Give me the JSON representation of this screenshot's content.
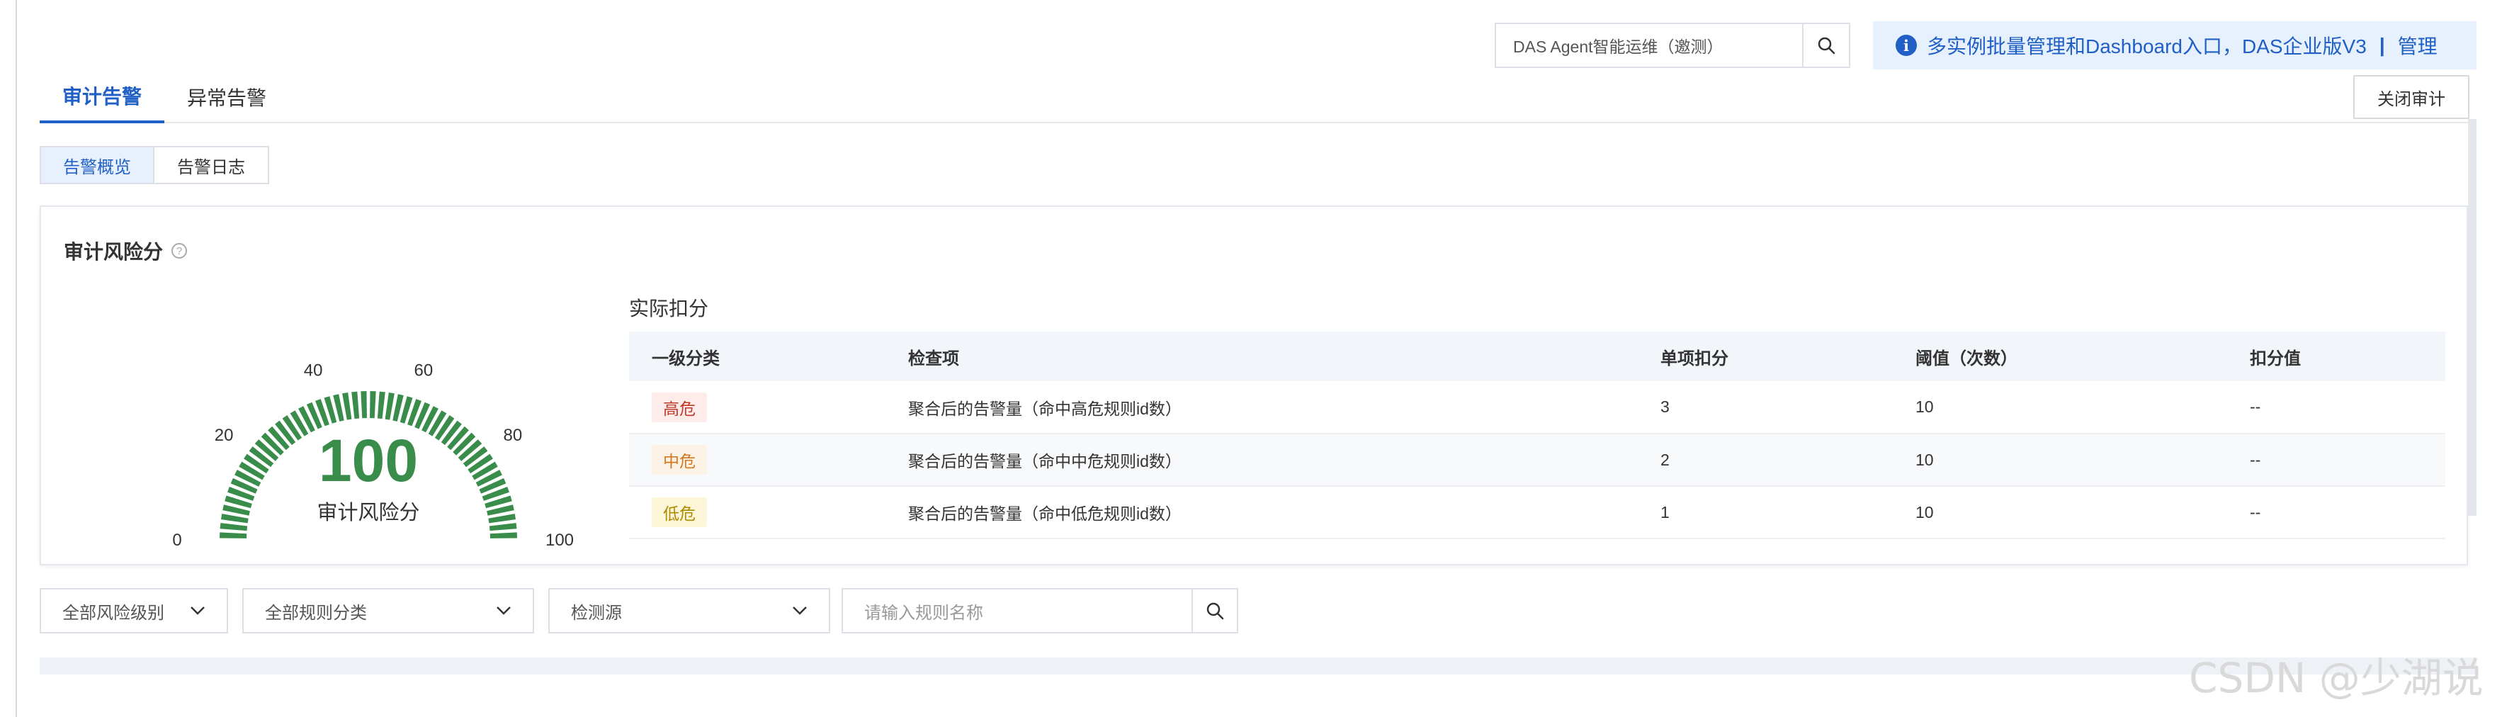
{
  "header": {
    "search_value": "DAS Agent智能运维（邀测）",
    "banner_text": "多实例批量管理和Dashboard入口，DAS企业版V3",
    "banner_sep": "|",
    "banner_link": "管理",
    "close_audit_label": "关闭审计"
  },
  "tabs": [
    {
      "label": "审计告警",
      "active": true
    },
    {
      "label": "异常告警",
      "active": false
    }
  ],
  "subtabs": [
    {
      "label": "告警概览",
      "active": true
    },
    {
      "label": "告警日志",
      "active": false
    }
  ],
  "risk_card": {
    "title": "审计风险分",
    "gauge": {
      "value": "100",
      "label": "审计风险分",
      "min": 0,
      "max": 100,
      "level": 100,
      "ticks": [
        "0",
        "20",
        "40",
        "60",
        "80",
        "100"
      ],
      "color": "#3a8c4b"
    },
    "deduction": {
      "title": "实际扣分",
      "columns": [
        "一级分类",
        "检查项",
        "单项扣分",
        "阈值（次数）",
        "扣分值"
      ],
      "rows": [
        {
          "level": "高危",
          "level_color": "#c0392b",
          "level_bg": "#fdecea",
          "item": "聚合后的告警量（命中高危规则id数）",
          "score": "3",
          "threshold": "10",
          "deduct": "--"
        },
        {
          "level": "中危",
          "level_color": "#d4781f",
          "level_bg": "#fdf2e6",
          "item": "聚合后的告警量（命中中危规则id数）",
          "score": "2",
          "threshold": "10",
          "deduct": "--"
        },
        {
          "level": "低危",
          "level_color": "#b08a00",
          "level_bg": "#fdf6d8",
          "item": "聚合后的告警量（命中低危规则id数）",
          "score": "1",
          "threshold": "10",
          "deduct": "--"
        }
      ]
    }
  },
  "filters": {
    "risk_level": "全部风险级别",
    "rule_category": "全部规则分类",
    "detect_source": "检测源",
    "rule_name_placeholder": "请输入规则名称"
  },
  "watermark": "CSDN @少湖说"
}
